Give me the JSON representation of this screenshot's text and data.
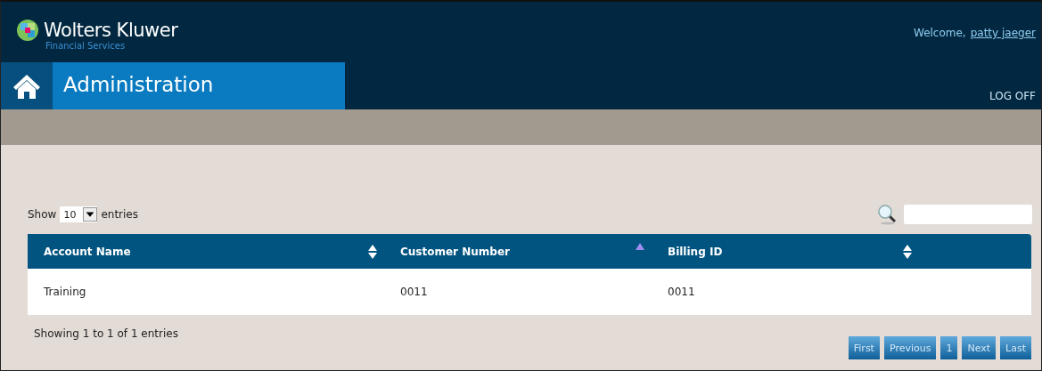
{
  "header": {
    "brand": "Wolters Kluwer",
    "subbrand": "Financial Services",
    "welcome": "Welcome,",
    "user": "patty jaeger",
    "logoff": "LOG OFF"
  },
  "nav": {
    "title": "Administration"
  },
  "length": {
    "before": "Show",
    "value": "10",
    "after": "entries"
  },
  "table": {
    "columns": [
      {
        "label": "Account Name",
        "sorted": false
      },
      {
        "label": "Customer Number",
        "sorted": true
      },
      {
        "label": "Billing ID",
        "sorted": false
      }
    ],
    "rows": [
      [
        "Training",
        "0011",
        "0011"
      ]
    ]
  },
  "info": "Showing 1 to 1 of 1 entries",
  "pager": [
    {
      "label": "First",
      "disabled": true
    },
    {
      "label": "Previous",
      "disabled": true
    },
    {
      "label": "1",
      "disabled": true
    },
    {
      "label": "Next",
      "disabled": true
    },
    {
      "label": "Last",
      "disabled": true
    }
  ]
}
